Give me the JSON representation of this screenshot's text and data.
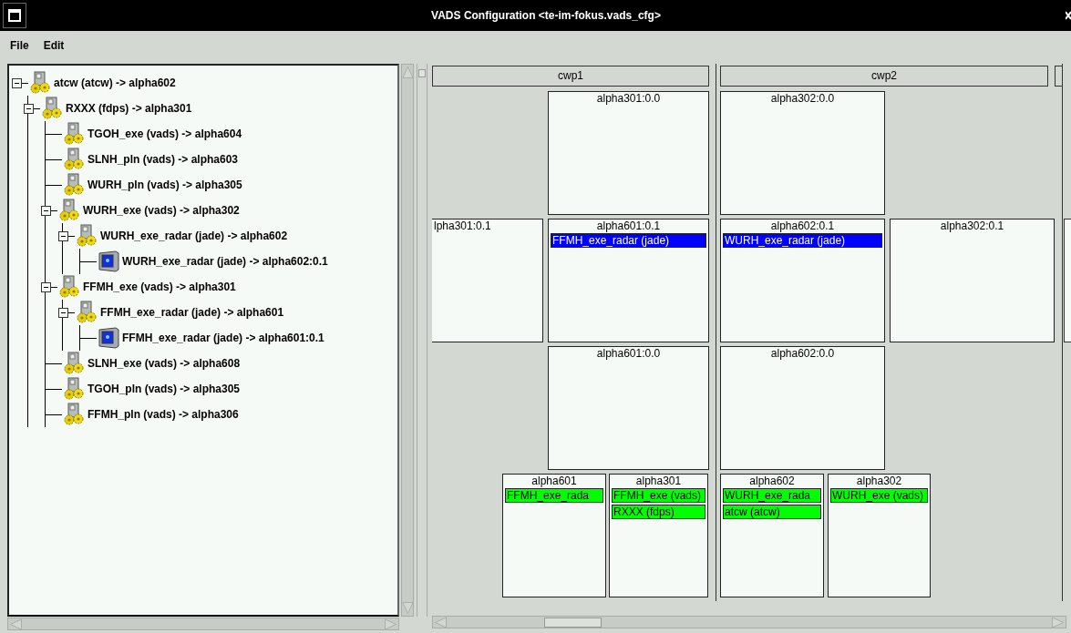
{
  "window": {
    "title": "VADS Configuration <te-im-fokus.vads_cfg>"
  },
  "menu": [
    {
      "label": "File"
    },
    {
      "label": "Edit"
    }
  ],
  "tree": [
    {
      "label": "atcw (atcw) -> alpha602",
      "kind": "process",
      "expanded": true,
      "children": [
        {
          "label": "RXXX (fdps) -> alpha301",
          "kind": "process",
          "expanded": true,
          "children": [
            {
              "label": "TGOH_exe (vads) -> alpha604",
              "kind": "process"
            },
            {
              "label": "SLNH_pln (vads) -> alpha603",
              "kind": "process"
            },
            {
              "label": "WURH_pln (vads) -> alpha305",
              "kind": "process"
            },
            {
              "label": "WURH_exe (vads) -> alpha302",
              "kind": "process",
              "expanded": true,
              "children": [
                {
                  "label": "WURH_exe_radar (jade) -> alpha602",
                  "kind": "process",
                  "expanded": true,
                  "children": [
                    {
                      "label": "WURH_exe_radar (jade) -> alpha602:0.1",
                      "kind": "display"
                    }
                  ]
                }
              ]
            },
            {
              "label": "FFMH_exe (vads) -> alpha301",
              "kind": "process",
              "expanded": true,
              "children": [
                {
                  "label": "FFMH_exe_radar (jade) -> alpha601",
                  "kind": "process",
                  "expanded": true,
                  "children": [
                    {
                      "label": "FFMH_exe_radar (jade) -> alpha601:0.1",
                      "kind": "display"
                    }
                  ]
                }
              ]
            },
            {
              "label": "SLNH_exe (vads) -> alpha608",
              "kind": "process"
            },
            {
              "label": "TGOH_pln (vads) -> alpha305",
              "kind": "process"
            },
            {
              "label": "FFMH_pln (vads) -> alpha306",
              "kind": "process"
            }
          ]
        }
      ]
    }
  ],
  "workspace": {
    "columns": [
      {
        "label": "cwp1"
      },
      {
        "label": "cwp2"
      }
    ],
    "displays": [
      {
        "label": "alpha301:0.0"
      },
      {
        "label": "alpha302:0.0"
      },
      {
        "label": "lpha301:0.1"
      },
      {
        "label": "alpha601:0.1",
        "tasks": [
          {
            "label": "FFMH_exe_radar (jade)",
            "color": "#0000ff"
          }
        ]
      },
      {
        "label": "alpha602:0.1",
        "tasks": [
          {
            "label": "WURH_exe_radar (jade)",
            "color": "#0000ff"
          }
        ]
      },
      {
        "label": "alpha302:0.1"
      },
      {
        "label": "alpha601:0.0"
      },
      {
        "label": "alpha602:0.0"
      },
      {
        "label": "alpha601",
        "tasks": [
          {
            "label": "FFMH_exe_rada",
            "color": "#00ff00"
          }
        ]
      },
      {
        "label": "alpha301",
        "tasks": [
          {
            "label": "FFMH_exe (vads)",
            "color": "#00ff00"
          },
          {
            "label": "RXXX (fdps)",
            "color": "#00ff00"
          }
        ]
      },
      {
        "label": "alpha602",
        "tasks": [
          {
            "label": "WURH_exe_rada",
            "color": "#00ff00"
          },
          {
            "label": "atcw (atcw)",
            "color": "#00ff00"
          }
        ]
      },
      {
        "label": "alpha302",
        "tasks": [
          {
            "label": "WURH_exe (vads)",
            "color": "#00ff00"
          }
        ]
      }
    ]
  }
}
